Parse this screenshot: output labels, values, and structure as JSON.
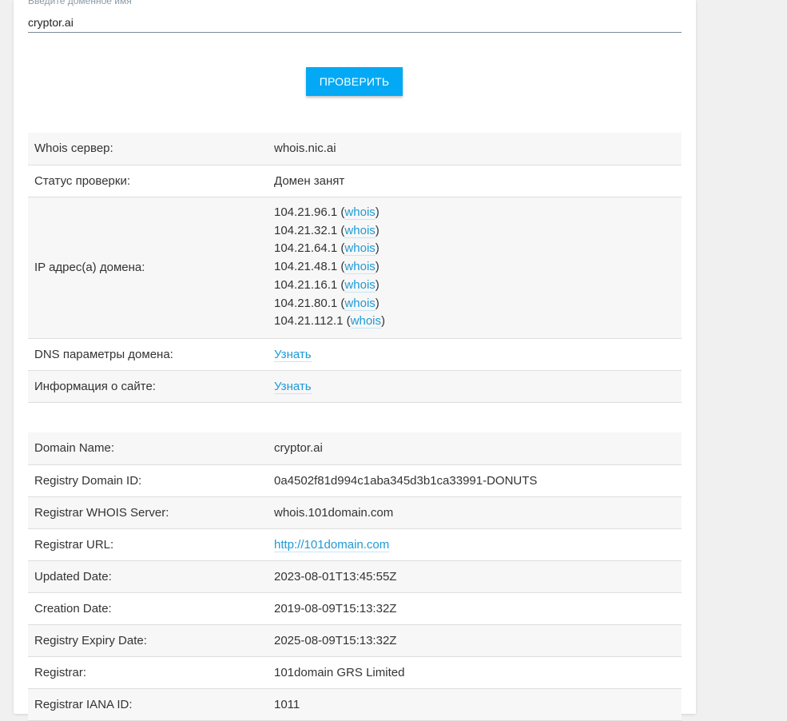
{
  "search": {
    "label": "Введите доменное имя",
    "value": "cryptor.ai",
    "button": "ПРОВЕРИТЬ"
  },
  "summary": {
    "whois_server_label": "Whois сервер:",
    "whois_server_value": "whois.nic.ai",
    "status_label": "Статус проверки:",
    "status_value": "Домен занят",
    "ip_label": "IP адрес(а) домена:",
    "ips": [
      {
        "ip": "104.21.96.1",
        "link": "whois"
      },
      {
        "ip": "104.21.32.1",
        "link": "whois"
      },
      {
        "ip": "104.21.64.1",
        "link": "whois"
      },
      {
        "ip": "104.21.48.1",
        "link": "whois"
      },
      {
        "ip": "104.21.16.1",
        "link": "whois"
      },
      {
        "ip": "104.21.80.1",
        "link": "whois"
      },
      {
        "ip": "104.21.112.1",
        "link": "whois"
      }
    ],
    "dns_label": "DNS параметры домена:",
    "dns_link": "Узнать",
    "site_info_label": "Информация о сайте:",
    "site_info_link": "Узнать"
  },
  "whois": {
    "rows": [
      {
        "key": "Domain Name:",
        "value": "cryptor.ai"
      },
      {
        "key": "Registry Domain ID:",
        "value": "0a4502f81d994c1aba345d3b1ca33991-DONUTS"
      },
      {
        "key": "Registrar WHOIS Server:",
        "value": "whois.101domain.com"
      },
      {
        "key": "Registrar URL:",
        "value": "http://101domain.com"
      },
      {
        "key": "Updated Date:",
        "value": "2023-08-01T13:45:55Z"
      },
      {
        "key": "Creation Date:",
        "value": "2019-08-09T15:13:32Z"
      },
      {
        "key": "Registry Expiry Date:",
        "value": "2025-08-09T15:13:32Z"
      },
      {
        "key": "Registrar:",
        "value": "101domain GRS Limited"
      },
      {
        "key": "Registrar IANA ID:",
        "value": "1011"
      }
    ]
  },
  "colors": {
    "accent": "#03a9f4",
    "link": "#1e9ad6",
    "background": "#f0f0f0"
  }
}
